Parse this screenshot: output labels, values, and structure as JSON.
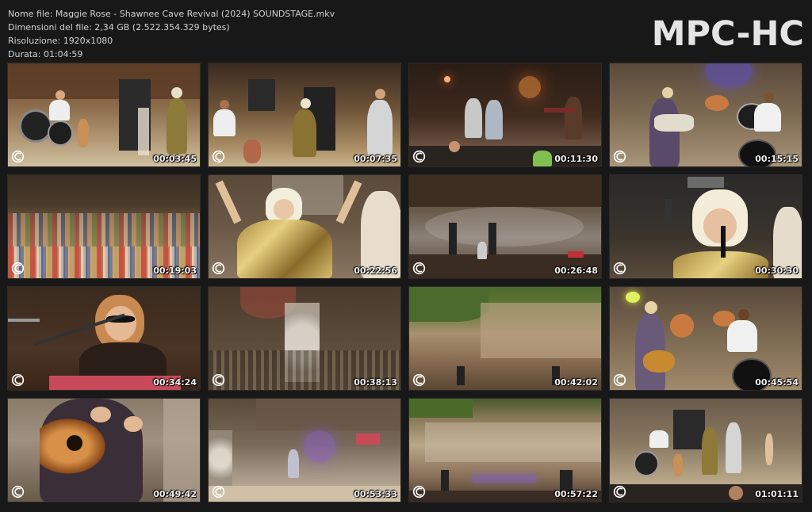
{
  "file_info": {
    "name_line": "Nome file: Maggie Rose - Shawnee Cave Revival (2024) SOUNDSTAGE.mkv",
    "size_line": "Dimensioni del file: 2,34 GB (2.522.354.329 bytes)",
    "resolution_line": "Risoluzione: 1920x1080",
    "duration_line": "Durata: 01:04:59"
  },
  "logo_text": "MPC-HC",
  "thumbnails": [
    {
      "timestamp": "00:03:45",
      "scene": "band-stage-drums"
    },
    {
      "timestamp": "00:07:35",
      "scene": "band-stage-wide"
    },
    {
      "timestamp": "00:11:30",
      "scene": "stage-dark-crowd"
    },
    {
      "timestamp": "00:15:15",
      "scene": "guitarist-drummer"
    },
    {
      "timestamp": "00:19:03",
      "scene": "crowd-wide"
    },
    {
      "timestamp": "00:22:56",
      "scene": "singer-arms-up"
    },
    {
      "timestamp": "00:26:48",
      "scene": "cave-stage-smoke"
    },
    {
      "timestamp": "00:30:30",
      "scene": "singer-closeup"
    },
    {
      "timestamp": "00:34:24",
      "scene": "singer-sunglasses-keys"
    },
    {
      "timestamp": "00:38:13",
      "scene": "flowers-stage"
    },
    {
      "timestamp": "00:42:02",
      "scene": "cave-rock-trees"
    },
    {
      "timestamp": "00:45:54",
      "scene": "guitarist-drummer-2"
    },
    {
      "timestamp": "00:49:42",
      "scene": "guitar-closeup"
    },
    {
      "timestamp": "00:53:33",
      "scene": "cave-stage-purple"
    },
    {
      "timestamp": "00:57:22",
      "scene": "cave-rock-lights"
    },
    {
      "timestamp": "01:01:11",
      "scene": "band-stage-audience"
    }
  ],
  "watermark_icon": "channel-logo-icon",
  "colors": {
    "background": "#181818",
    "text": "#d2d2d2",
    "logo": "#e4e4e4"
  }
}
